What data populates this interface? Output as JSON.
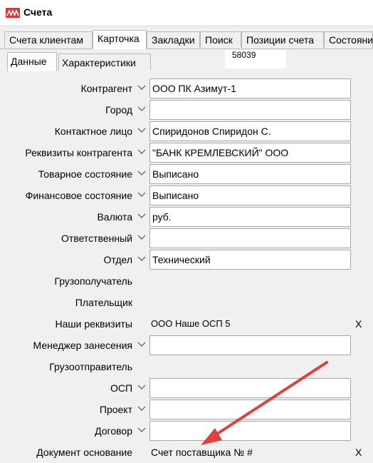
{
  "window": {
    "title": "Счета"
  },
  "tabs": [
    {
      "label": "Счета клиентам"
    },
    {
      "label": "Карточка"
    },
    {
      "label": "Закладки"
    },
    {
      "label": "Поиск"
    },
    {
      "label": "Позиции счета"
    },
    {
      "label": "Состояния"
    }
  ],
  "subtabs": [
    {
      "label": "Данные"
    },
    {
      "label": "Характеристики"
    }
  ],
  "document_number": "58039",
  "fields": [
    {
      "label": "Контрагент",
      "value": "ООО ПК Азимут-1"
    },
    {
      "label": "Город",
      "value": ""
    },
    {
      "label": "Контактное лицо",
      "value": "Спиридонов Спиридон С."
    },
    {
      "label": "Реквизиты контрагента",
      "value": "\"БАНК КРЕМЛЕВСКИЙ\" ООО"
    },
    {
      "label": "Товарное состояние",
      "value": "Выписано"
    },
    {
      "label": "Финансовое состояние",
      "value": "Выписано"
    },
    {
      "label": "Валюта",
      "value": "руб."
    },
    {
      "label": "Ответственный",
      "value": ""
    },
    {
      "label": "Отдел",
      "value": "Технический"
    },
    {
      "label": "Грузополучатель"
    },
    {
      "label": "Плательщик"
    },
    {
      "label": "Наши реквизиты",
      "value": "ООО Наше ОСП 5",
      "clear": "X"
    },
    {
      "label": "Менеджер занесения",
      "value": ""
    },
    {
      "label": "Грузоотправитель"
    },
    {
      "label": "ОСП",
      "value": ""
    },
    {
      "label": "Проект",
      "value": ""
    },
    {
      "label": "Договор",
      "value": ""
    },
    {
      "label": "Документ основание",
      "value": "Счет поставщика № #",
      "clear": "X"
    }
  ],
  "colors": {
    "accent": "#e03232",
    "arrow": "#e0413a"
  }
}
